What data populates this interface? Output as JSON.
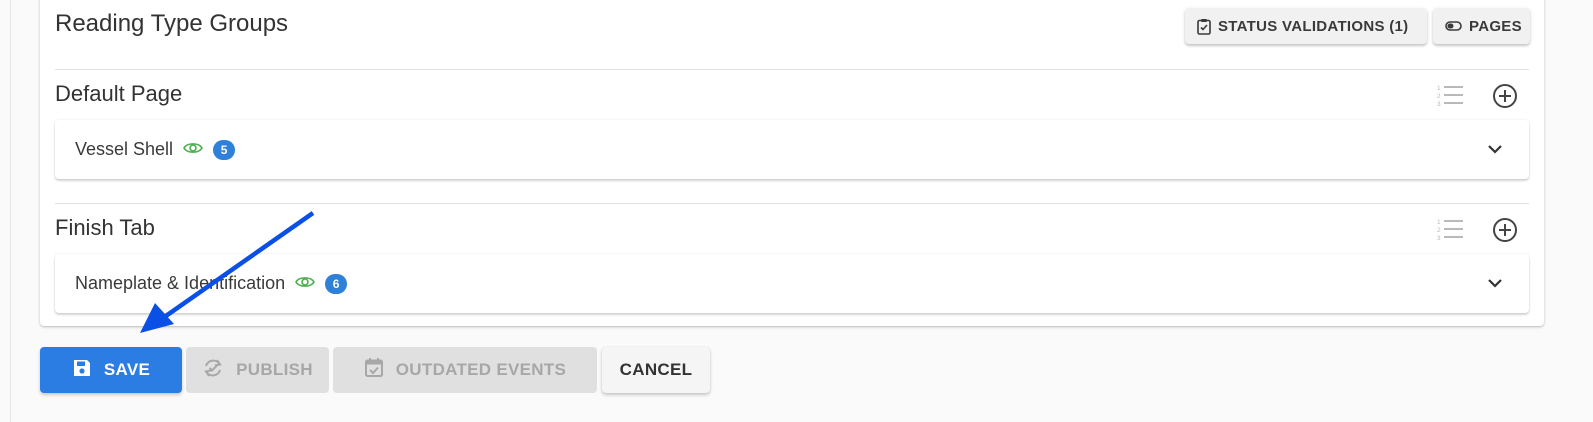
{
  "header": {
    "title": "Reading Type Groups",
    "status_validations_label": "STATUS VALIDATIONS (1)",
    "pages_label": "PAGES"
  },
  "sections": [
    {
      "title": "Default Page",
      "group": {
        "label": "Vessel Shell",
        "count": "5"
      }
    },
    {
      "title": "Finish Tab",
      "group": {
        "label": "Nameplate & Identification",
        "count": "6"
      }
    }
  ],
  "actions": {
    "save": "SAVE",
    "publish": "PUBLISH",
    "outdated_events": "OUTDATED EVENTS",
    "cancel": "CANCEL"
  },
  "icons": {
    "status_validations": "clipboard-check-icon",
    "pages": "toggle-icon",
    "reorder": "format-list-numbered-icon",
    "add": "plus-circle-outline-icon",
    "visibility": "eye-icon",
    "expand": "chevron-down-icon",
    "save": "content-save-icon",
    "publish": "sync-icon",
    "outdated_events": "calendar-check-icon",
    "annotation": "arrow-icon"
  },
  "colors": {
    "primary": "#2b7de3",
    "badge": "#2f80d9",
    "visible": "#4caf50",
    "annotation_arrow": "#0a4fe6"
  }
}
